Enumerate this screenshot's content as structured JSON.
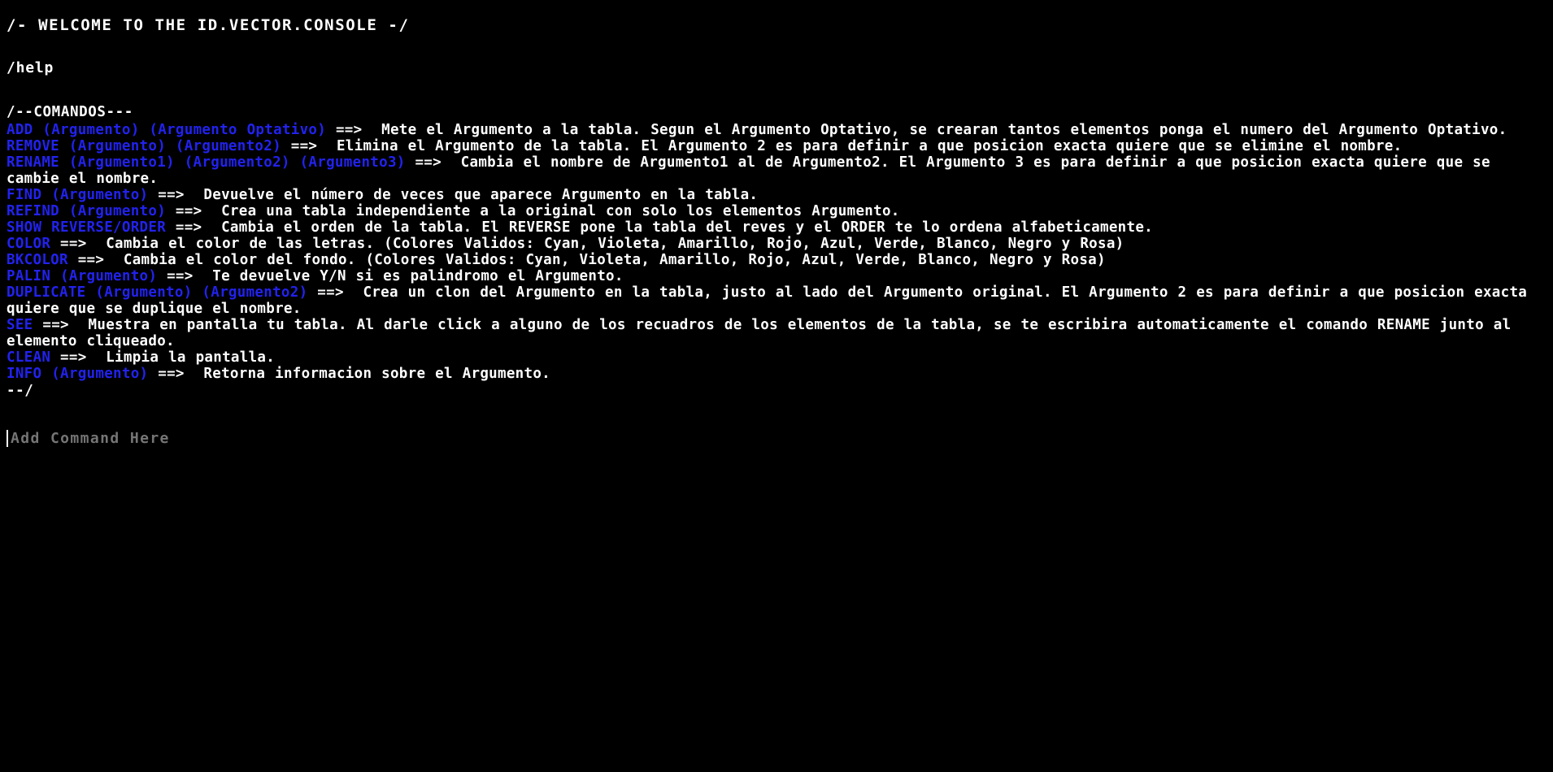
{
  "console": {
    "welcome": "/- WELCOME TO THE ID.VECTOR.CONSOLE -/",
    "entered_command": "/help",
    "section_open_marker": "/--COMANDOS---",
    "section_close_marker": "--/",
    "text_color": "#ffffff",
    "keyword_color": "#2222ee",
    "background_color": "#000000",
    "placeholder_color": "#808080"
  },
  "commands": [
    {
      "name": "ADD",
      "args": "(Argumento) (Argumento Optativo)",
      "arrow": "==>",
      "description": "Mete el Argumento a la tabla. Segun el Argumento Optativo, se crearan tantos elementos ponga el numero del Argumento Optativo."
    },
    {
      "name": "REMOVE",
      "args": "(Argumento) (Argumento2)",
      "arrow": "==>",
      "description": "Elimina el Argumento de la tabla. El Argumento 2 es para definir a que posicion exacta quiere que se elimine el nombre."
    },
    {
      "name": "RENAME",
      "args": "(Argumento1) (Argumento2) (Argumento3)",
      "arrow": "==>",
      "description": "Cambia el nombre de Argumento1 al de Argumento2. El Argumento 3 es para definir a que posicion exacta quiere que se cambie el nombre."
    },
    {
      "name": "FIND",
      "args": "(Argumento)",
      "arrow": "==>",
      "description": "Devuelve el número de veces que aparece Argumento en la tabla."
    },
    {
      "name": "REFIND",
      "args": "(Argumento)",
      "arrow": "==>",
      "description": "Crea una tabla independiente a la original con solo los elementos Argumento."
    },
    {
      "name": "SHOW REVERSE/ORDER",
      "args": "",
      "arrow": "==>",
      "description": "Cambia el orden de la tabla. El REVERSE pone la tabla del reves y el ORDER te lo ordena alfabeticamente."
    },
    {
      "name": "COLOR",
      "args": "",
      "arrow": "==>",
      "description": "Cambia el color de las letras. (Colores Validos: Cyan, Violeta, Amarillo, Rojo, Azul, Verde, Blanco, Negro y Rosa)"
    },
    {
      "name": "BKCOLOR",
      "args": "",
      "arrow": "==>",
      "description": "Cambia el color del fondo. (Colores Validos: Cyan, Violeta, Amarillo, Rojo, Azul, Verde, Blanco, Negro y Rosa)"
    },
    {
      "name": "PALIN",
      "args": "(Argumento)",
      "arrow": "==>",
      "description": "Te devuelve Y/N si es palindromo el Argumento."
    },
    {
      "name": "DUPLICATE",
      "args": "(Argumento) (Argumento2)",
      "arrow": "==>",
      "description": "Crea un clon del Argumento en la tabla, justo al lado del Argumento original. El Argumento 2 es para definir a que posicion exacta quiere que se duplique el nombre."
    },
    {
      "name": "SEE",
      "args": "",
      "arrow": "==>",
      "description": "Muestra en pantalla tu tabla. Al darle click a alguno de los recuadros de los elementos de la tabla, se te escribira automaticamente el comando RENAME junto al elemento cliqueado."
    },
    {
      "name": "CLEAN",
      "args": "",
      "arrow": "==>",
      "description": "Limpia la pantalla."
    },
    {
      "name": "INFO",
      "args": "(Argumento)",
      "arrow": "==>",
      "description": "Retorna informacion sobre el Argumento."
    }
  ],
  "input": {
    "value": "",
    "placeholder": "Add Command Here"
  }
}
